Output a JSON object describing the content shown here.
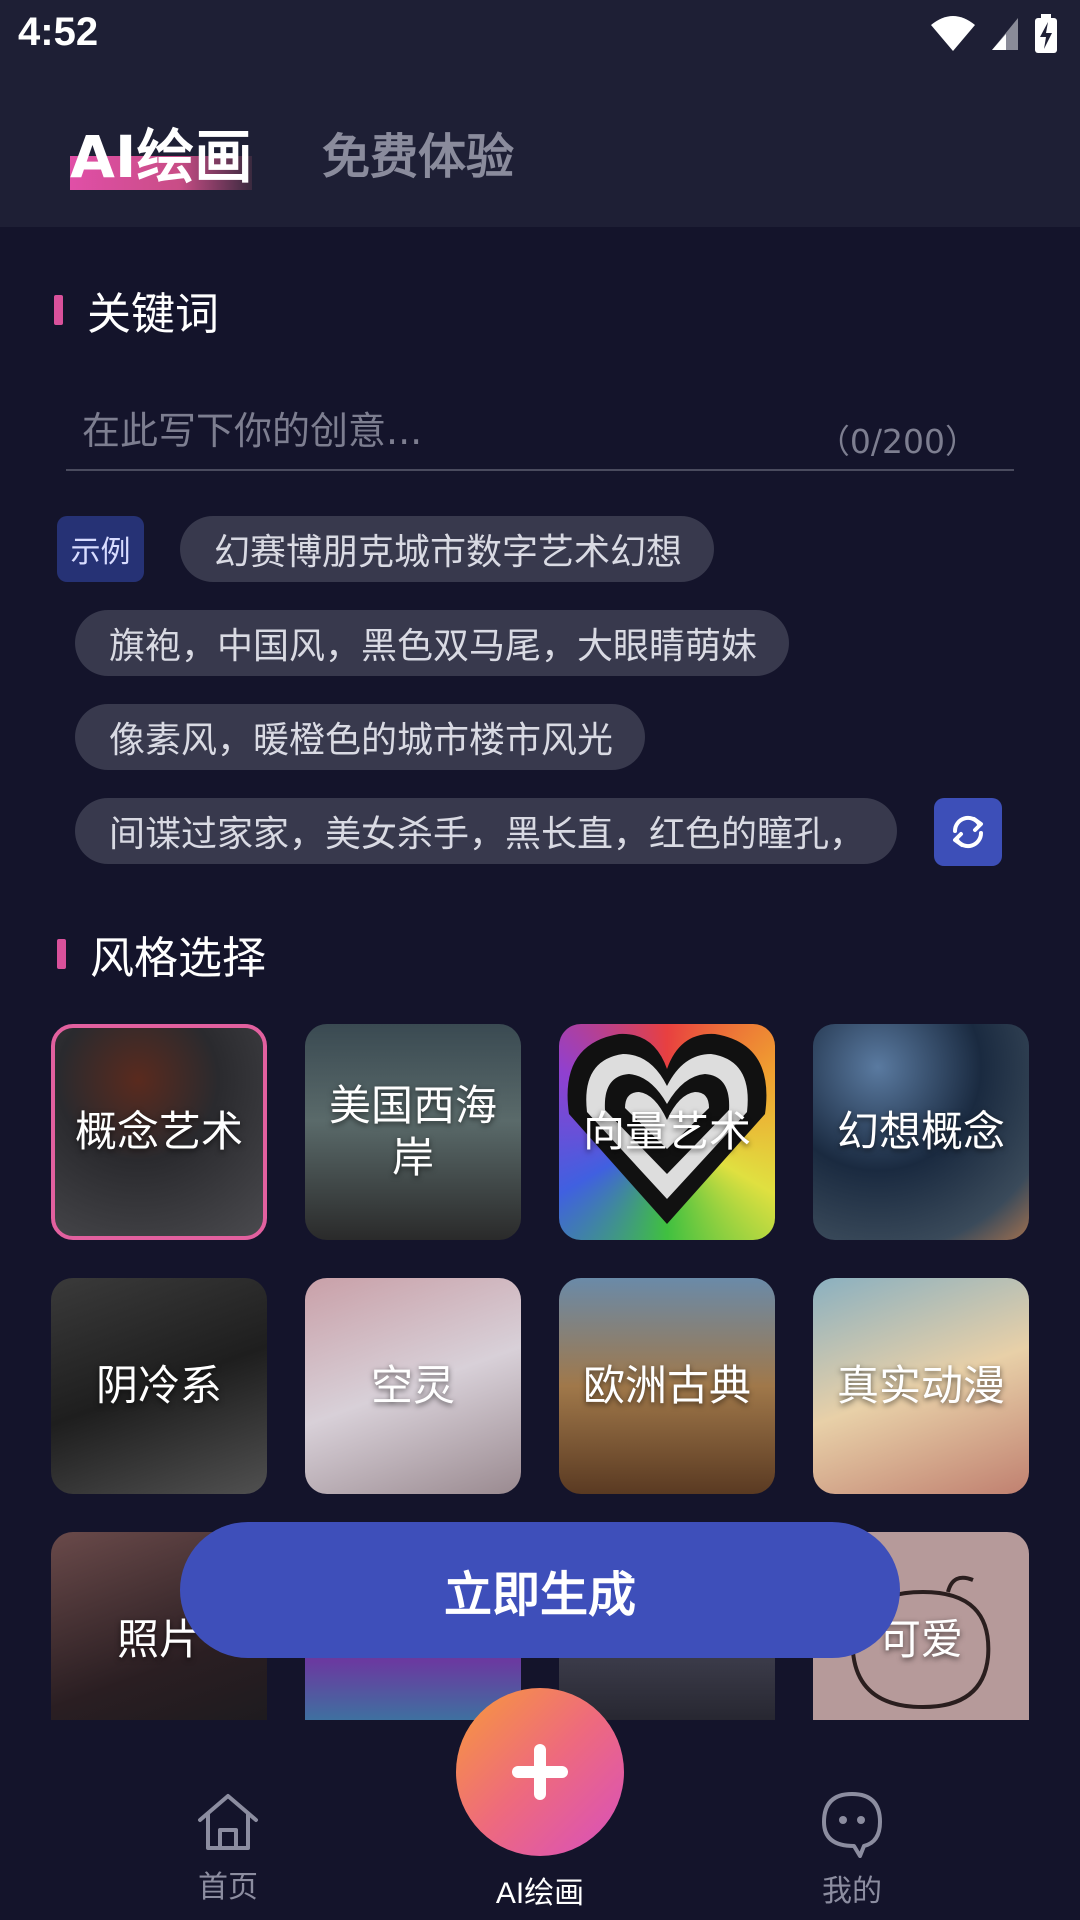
{
  "status_bar": {
    "time": "4:52"
  },
  "header": {
    "tabs": [
      {
        "label": "AI绘画",
        "active": true
      },
      {
        "label": "免费体验",
        "active": false
      }
    ]
  },
  "keywords": {
    "section_title": "关键词",
    "input": {
      "placeholder": "在此写下你的创意...",
      "value": "",
      "counter": "（0/200）"
    },
    "example_label": "示例",
    "examples": [
      "幻赛博朋克城市数字艺术幻想",
      "旗袍，中国风，黑色双马尾，大眼睛萌妹",
      "像素风，暖橙色的城市楼市风光",
      "间谍过家家，美女杀手，黑长直，红色的瞳孔，"
    ]
  },
  "styles": {
    "section_title": "风格选择",
    "items": [
      {
        "label": "概念艺术",
        "selected": true
      },
      {
        "label": "美国西海岸",
        "selected": false
      },
      {
        "label": "向量艺术",
        "selected": false
      },
      {
        "label": "幻想概念",
        "selected": false
      },
      {
        "label": "阴冷系",
        "selected": false
      },
      {
        "label": "空灵",
        "selected": false
      },
      {
        "label": "欧洲古典",
        "selected": false
      },
      {
        "label": "真实动漫",
        "selected": false
      },
      {
        "label": "照片",
        "selected": false
      },
      {
        "label": "",
        "selected": false
      },
      {
        "label": "",
        "selected": false
      },
      {
        "label": "可爱",
        "selected": false
      }
    ]
  },
  "generate_button": {
    "label": "立即生成"
  },
  "bottom_nav": {
    "items": [
      {
        "label": "首页",
        "icon": "home-icon"
      },
      {
        "label": "AI绘画",
        "icon": "plus-icon"
      },
      {
        "label": "我的",
        "icon": "ghost-icon"
      }
    ]
  },
  "colors": {
    "accent_pink": "#d9519b",
    "primary_blue": "#3e4fba",
    "background": "#14142b"
  }
}
